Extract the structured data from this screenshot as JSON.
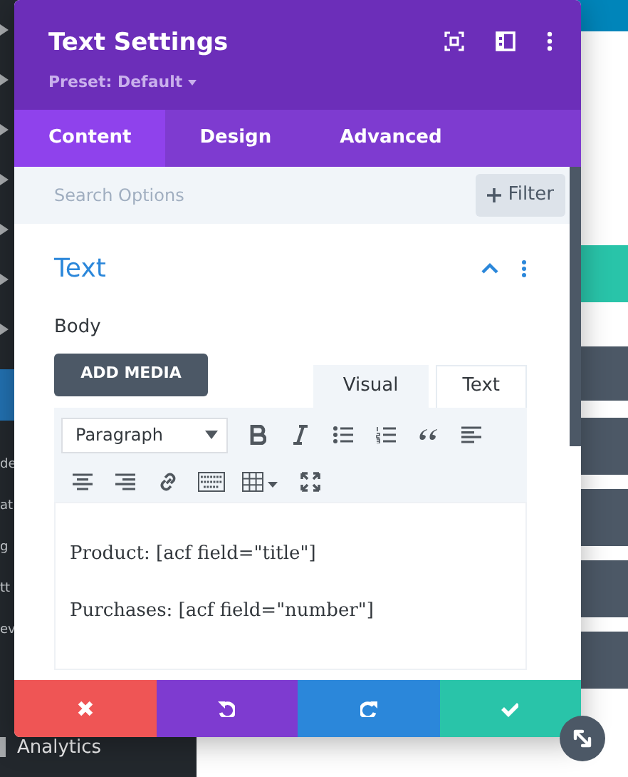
{
  "sidebar": {
    "items": [
      {
        "label": "de"
      },
      {
        "label": "at"
      },
      {
        "label": "g"
      },
      {
        "label": "tt"
      },
      {
        "label": "ev"
      },
      {
        "label": "Analytics"
      }
    ]
  },
  "modal": {
    "title": "Text Settings",
    "preset": "Preset: Default",
    "tabs": [
      {
        "label": "Content",
        "selected": true
      },
      {
        "label": "Design",
        "selected": false
      },
      {
        "label": "Advanced",
        "selected": false
      }
    ],
    "search": {
      "placeholder": "Search Options"
    },
    "filter_button": "Filter",
    "section": {
      "title": "Text",
      "expanded": true,
      "field_label": "Body",
      "add_media": "ADD MEDIA",
      "editor_tabs": [
        {
          "label": "Visual",
          "selected": true
        },
        {
          "label": "Text",
          "selected": false
        }
      ],
      "format_select": "Paragraph",
      "content": [
        "Product: [acf field=\"title\"]",
        "Purchases: [acf field=\"number\"]"
      ]
    },
    "footer_buttons": [
      {
        "kind": "cancel"
      },
      {
        "kind": "undo"
      },
      {
        "kind": "redo"
      },
      {
        "kind": "save"
      }
    ]
  }
}
